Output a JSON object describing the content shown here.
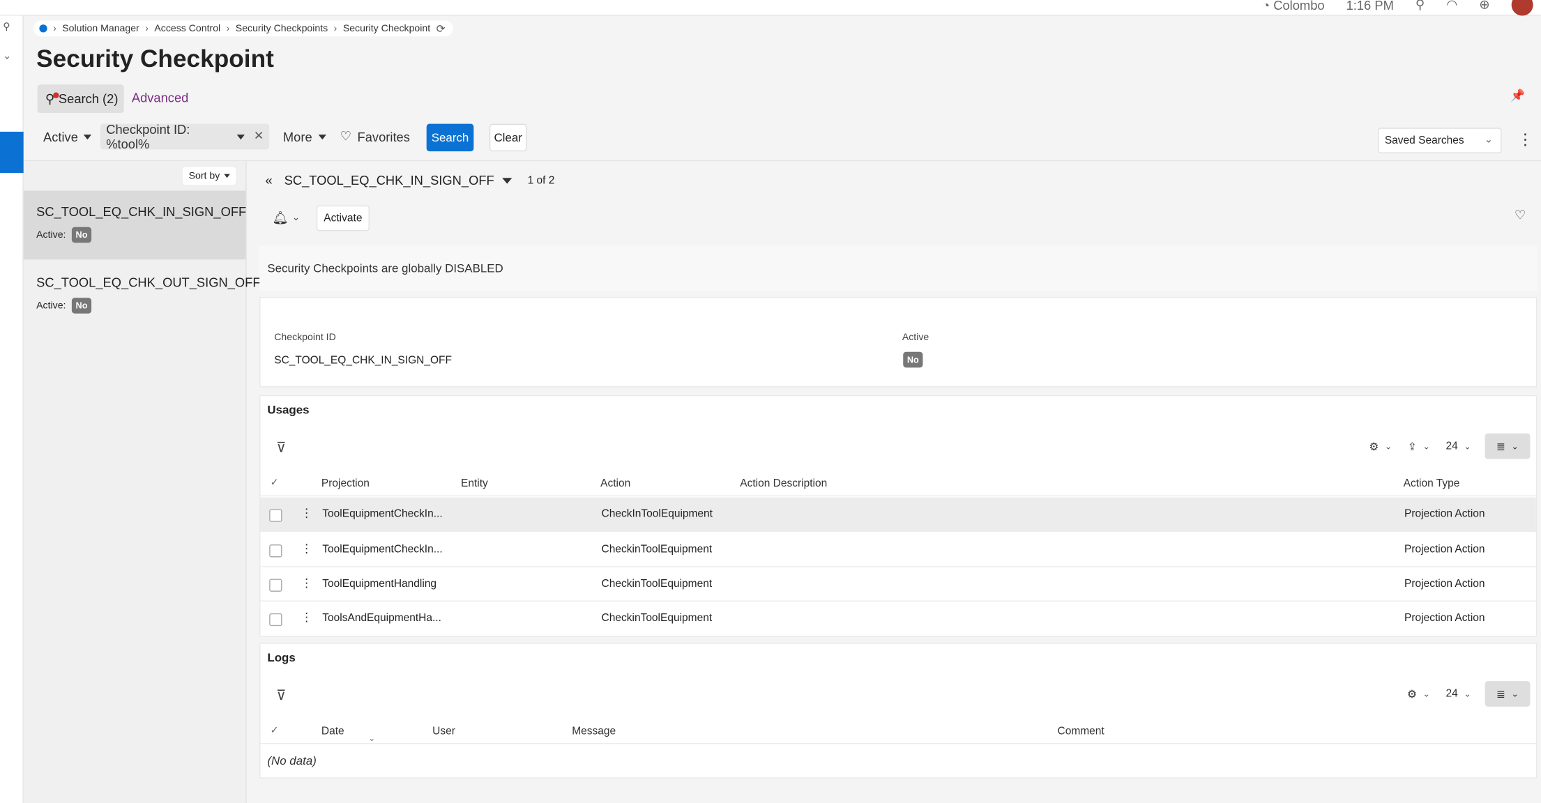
{
  "topbar": {
    "location": "Colombo",
    "time": "1:16 PM"
  },
  "breadcrumb": [
    "Solution Manager",
    "Access Control",
    "Security Checkpoints",
    "Security Checkpoint"
  ],
  "page_title": "Security Checkpoint",
  "search_tab": {
    "label": "Search (2)"
  },
  "advanced_label": "Advanced",
  "filters": {
    "active_label": "Active",
    "checkpoint_chip": "Checkpoint ID: %tool%",
    "more_label": "More",
    "favorites_label": "Favorites",
    "search_button": "Search",
    "clear_button": "Clear",
    "saved_searches": "Saved Searches"
  },
  "list": {
    "sort_label": "Sort by",
    "items": [
      {
        "name": "SC_TOOL_EQ_CHK_IN_SIGN_OFF",
        "active_label": "Active:",
        "active_value": "No"
      },
      {
        "name": "SC_TOOL_EQ_CHK_OUT_SIGN_OFF",
        "active_label": "Active:",
        "active_value": "No"
      }
    ]
  },
  "detail": {
    "record_name": "SC_TOOL_EQ_CHK_IN_SIGN_OFF",
    "record_count": "1 of 2",
    "activate_button": "Activate",
    "banner": "Security Checkpoints are globally DISABLED",
    "fields": {
      "checkpoint_id_label": "Checkpoint ID",
      "checkpoint_id_value": "SC_TOOL_EQ_CHK_IN_SIGN_OFF",
      "active_label": "Active",
      "active_value": "No"
    }
  },
  "usages": {
    "title": "Usages",
    "page_size": "24",
    "columns": [
      "Projection",
      "Entity",
      "Action",
      "Action Description",
      "Action Type"
    ],
    "rows": [
      {
        "projection": "ToolEquipmentCheckIn...",
        "entity": "",
        "action": "CheckInToolEquipment",
        "description": "",
        "type": "Projection Action"
      },
      {
        "projection": "ToolEquipmentCheckIn...",
        "entity": "",
        "action": "CheckinToolEquipment",
        "description": "",
        "type": "Projection Action"
      },
      {
        "projection": "ToolEquipmentHandling",
        "entity": "",
        "action": "CheckinToolEquipment",
        "description": "",
        "type": "Projection Action"
      },
      {
        "projection": "ToolsAndEquipmentHa...",
        "entity": "",
        "action": "CheckinToolEquipment",
        "description": "",
        "type": "Projection Action"
      }
    ]
  },
  "logs": {
    "title": "Logs",
    "page_size": "24",
    "columns": [
      "Date",
      "User",
      "Message",
      "Comment"
    ],
    "empty_text": "(No data)"
  }
}
